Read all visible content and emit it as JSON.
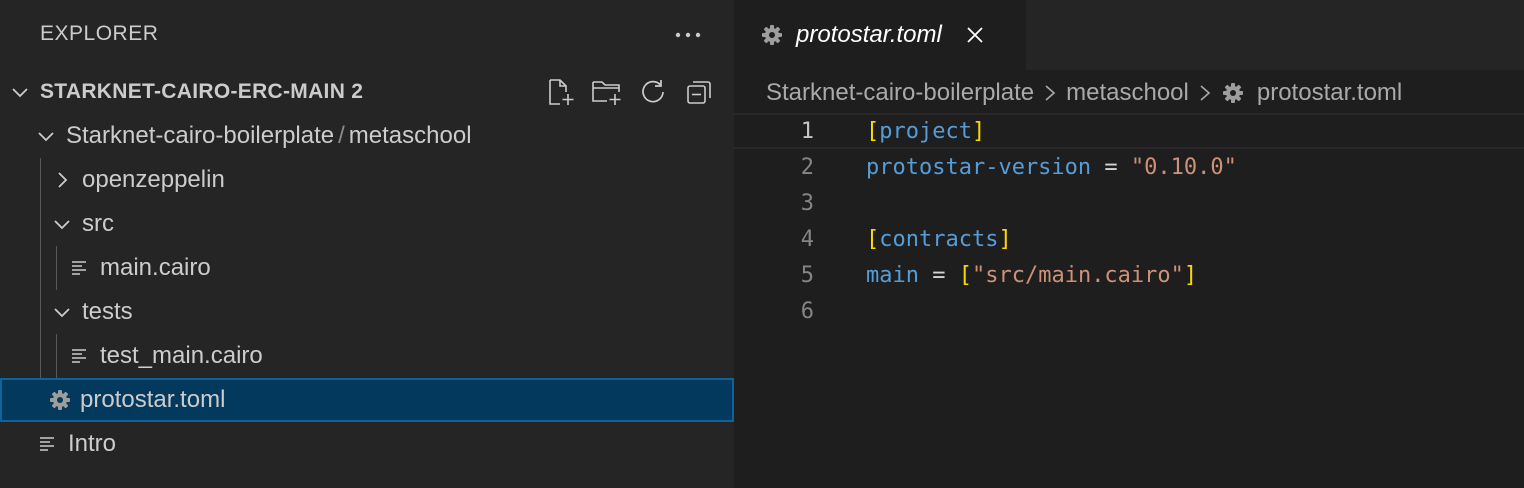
{
  "sidebar": {
    "title": "EXPLORER",
    "more_actions_icon": "ellipsis-icon",
    "section": {
      "label": "STARKNET-CAIRO-ERC-MAIN 2",
      "actions": [
        "new-file-icon",
        "new-folder-icon",
        "refresh-icon",
        "collapse-all-icon"
      ]
    },
    "tree": {
      "root_folder": {
        "label": "Starknet-cairo-boilerplate",
        "separator": "/",
        "sublabel": "metaschool"
      },
      "openzeppelin": {
        "label": "openzeppelin"
      },
      "src": {
        "label": "src"
      },
      "src_main": {
        "label": "main.cairo"
      },
      "tests": {
        "label": "tests"
      },
      "tests_main": {
        "label": "test_main.cairo"
      },
      "protostar": {
        "label": "protostar.toml"
      },
      "intro": {
        "label": "Intro"
      }
    }
  },
  "editor": {
    "tab": {
      "label": "protostar.toml",
      "icon": "gear-icon",
      "close_icon": "close-icon"
    },
    "breadcrumbs": [
      "Starknet-cairo-boilerplate",
      "metaschool",
      "protostar.toml"
    ],
    "line_numbers": [
      "1",
      "2",
      "3",
      "4",
      "5",
      "6"
    ],
    "code": {
      "l1": {
        "open": "[",
        "name": "project",
        "close": "]"
      },
      "l2": {
        "key": "protostar-version",
        "eq": " = ",
        "value": "\"0.10.0\""
      },
      "l4": {
        "open": "[",
        "name": "contracts",
        "close": "]"
      },
      "l5": {
        "key": "main",
        "eq": " = ",
        "open": "[",
        "value": "\"src/main.cairo\"",
        "close": "]"
      }
    }
  },
  "colors": {
    "sidebar_bg": "#252526",
    "editor_bg": "#1e1e1e",
    "selection_bg": "#04395e",
    "selection_border": "#0e639c",
    "keyword_blue": "#569cd6",
    "bracket_yellow": "#ffd700",
    "string_orange": "#ce9178"
  }
}
